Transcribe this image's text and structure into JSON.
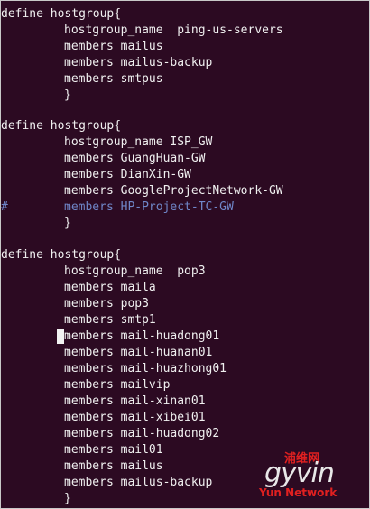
{
  "block1": {
    "define": "define hostgroup{",
    "name": "hostgroup_name  ping-us-servers",
    "members": [
      "members mailus",
      "members mailus-backup",
      "members smtpus"
    ],
    "close": "}"
  },
  "block2": {
    "define": "define hostgroup{",
    "name": "hostgroup_name ISP_GW",
    "members": [
      "members GuangHuan-GW",
      "members DianXin-GW",
      "members GoogleProjectNetwork-GW"
    ],
    "comment_hash": "#",
    "comment_line": "members HP-Project-TC-GW",
    "close": "}"
  },
  "block3": {
    "define": "define hostgroup{",
    "name": "hostgroup_name  pop3",
    "members": [
      "members maila",
      "members pop3",
      "members smtp1",
      "members mail-huadong01",
      "members mail-huanan01",
      "members mail-huazhong01",
      "members mailvip",
      "members mail-xinan01",
      "members mail-xibei01",
      "members mail-huadong02",
      "members mail01",
      "members mailus",
      "members mailus-backup"
    ],
    "close": "}"
  },
  "watermark": {
    "top": "浦维网",
    "logo": "gyvin",
    "bottom": "Yun Network"
  },
  "colors": {
    "background": "#2c0a22",
    "text": "#f0f0f0",
    "comment": "#6f86c8",
    "watermark_red": "#e02020",
    "watermark_blue": "#2f4fd0"
  }
}
